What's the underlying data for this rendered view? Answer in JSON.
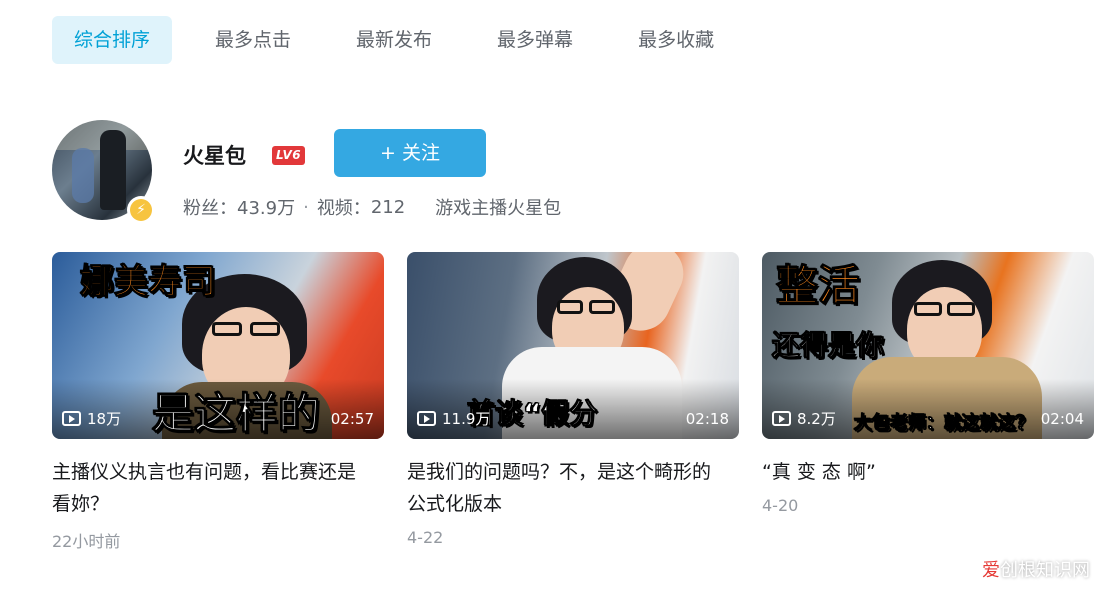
{
  "tabs": [
    {
      "label": "综合排序",
      "active": true
    },
    {
      "label": "最多点击",
      "active": false
    },
    {
      "label": "最新发布",
      "active": false
    },
    {
      "label": "最多弹幕",
      "active": false
    },
    {
      "label": "最多收藏",
      "active": false
    }
  ],
  "uploader": {
    "name": "火星包",
    "level": "LV6",
    "follow_label": "+ 关注",
    "fans_label": "粉丝：",
    "fans": "43.9万",
    "sep": "·",
    "videos_label": "视频：",
    "videos": "212",
    "description": "游戏主播火星包"
  },
  "videos": [
    {
      "overlay_top": "娜美寿司",
      "overlay_bottom": "是这样的",
      "views": "18万",
      "duration": "02:57",
      "title": "主播仪义执言也有问题，看比赛还是看妳？",
      "date": "22小时前"
    },
    {
      "overlay_bottom": "首谈“假分",
      "views": "11.9万",
      "duration": "02:18",
      "title": "是我们的问题吗？不，是这个畸形的公式化版本",
      "date": "4-22"
    },
    {
      "overlay_top": "整活",
      "overlay_mid": "还得是你",
      "overlay_bottom": "大包老师：就这就这？",
      "views": "8.2万",
      "duration": "02:04",
      "title": "“真 变 态 啊”",
      "date": "4-20"
    }
  ],
  "watermark": {
    "brand": "爱",
    "rest": "创根知识网"
  },
  "colors": {
    "accent": "#00a1d6",
    "follow": "#34a8e2",
    "level": "#e2383a"
  }
}
